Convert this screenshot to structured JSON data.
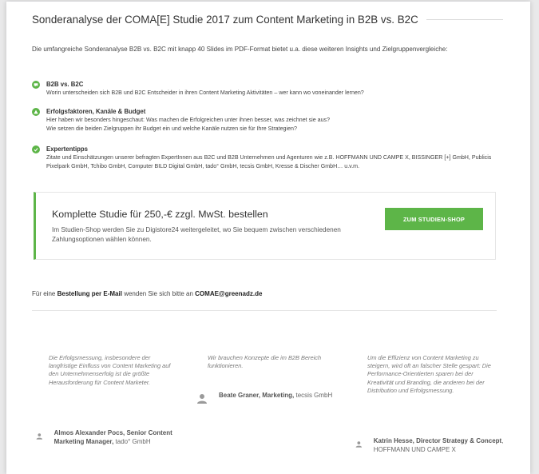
{
  "heading": {
    "title": "Sonderanalyse der COMA[E] Studie 2017 zum Content Marketing in B2B vs. B2C"
  },
  "intro": "Die umfangreiche Sonderanalyse B2B vs. B2C mit knapp 40 Slides im PDF-Format bietet u.a. diese weiteren Insights und Zielgruppenvergleiche:",
  "features": [
    {
      "icon": "chat-icon",
      "title": "B2B vs. B2C",
      "lines": [
        "Worin unterscheiden sich B2B und B2C Entscheider in ihren Content Marketing Aktivitäten – wer kann wo voneinander lernen?"
      ]
    },
    {
      "icon": "warning-icon",
      "title": "Erfolgsfaktoren, Kanäle & Budget",
      "lines": [
        "Hier haben wir besonders hingeschaut: Was machen die Erfolgreichen unter ihnen besser, was zeichnet sie aus?",
        "Wie setzen die beiden Zielgruppen ihr Budget ein und welche Kanäle nutzen sie für Ihre Strategien?"
      ]
    },
    {
      "icon": "check-icon",
      "title": "Expertentipps",
      "lines": [
        "Zitate und Einschätzungen unserer befragten ExpertInnen aus B2C und B2B Unternehmen und Agenturen wie z.B. HOFFMANN UND CAMPE X, BISSINGER [+] GmbH, Publicis Pixelpark GmbH, Tchibo GmbH, Computer BILD Digital GmbH, tado° GmbH, tecsis GmbH, Kresse & Discher GmbH… u.v.m."
      ]
    }
  ],
  "cta": {
    "title": "Komplette Studie für 250,-€ zzgl. MwSt. bestellen",
    "description": "Im Studien-Shop werden Sie zu Digistore24 weitergeleitet, wo Sie bequem zwischen verschiedenen Zahlungsoptionen wählen können.",
    "button_label": "ZUM STUDIEN-SHOP"
  },
  "email": {
    "prefix": "Für eine",
    "order_word": "Bestellung per E-Mail",
    "middle": "wenden Sie sich bitte an",
    "address": "COMAE@greenadz.de"
  },
  "testimonials": [
    {
      "quote": "Die Erfolgsmessung, insbesondere der langfristige Einfluss von Content Marketing auf den Unternehmenserfolg ist die größte Herausforderung für Content Marketer.",
      "name": "Almos Alexander Pocs, Senior Content Marketing Manager,",
      "company": "tado° GmbH"
    },
    {
      "quote": "Wir brauchen Konzepte die im B2B Bereich funktionieren.",
      "name": "Beate Graner, Marketing,",
      "company": "tecsis GmbH"
    },
    {
      "quote": "Um die Effizienz von Content Marketing zu steigern, wird oft an falscher Stelle gespart: Die Performance-Orientierten sparen bei der Kreativität und Branding, die anderen bei der Distribution und Erfolgsmessung.",
      "name": "Katrin Hesse, Director Strategy & Concept",
      "company": ", HOFFMANN UND CAMPE X"
    }
  ],
  "colors": {
    "accent": "#5db548",
    "background": "#e9e9ea"
  }
}
